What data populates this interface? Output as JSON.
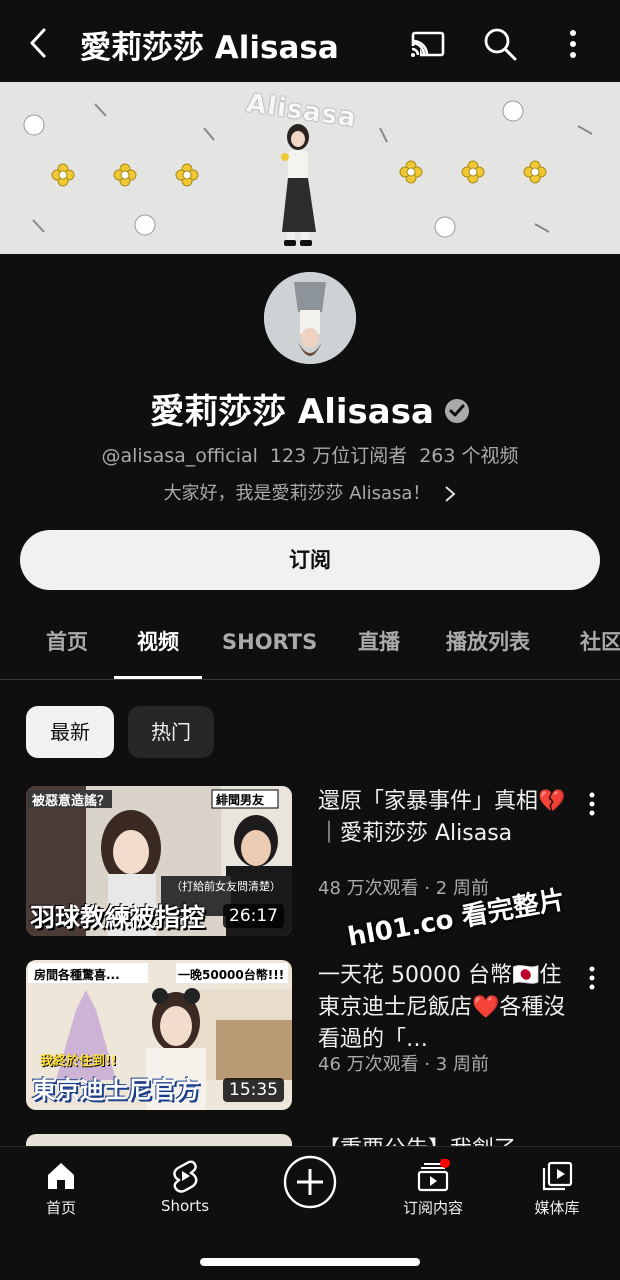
{
  "header": {
    "title": "愛莉莎莎 Alisasa"
  },
  "banner": {
    "brand_text": "Alisasa"
  },
  "channel": {
    "name": "愛莉莎莎 Alisasa",
    "handle": "@alisasa_official",
    "subscribers": "123 万位订阅者",
    "video_count": "263 个视频",
    "description": "大家好，我是愛莉莎莎 Alisasa！"
  },
  "subscribe_label": "订阅",
  "tabs": [
    {
      "label": "首页"
    },
    {
      "label": "视频"
    },
    {
      "label": "SHORTS"
    },
    {
      "label": "直播"
    },
    {
      "label": "播放列表"
    },
    {
      "label": "社区"
    }
  ],
  "filters": {
    "latest": "最新",
    "popular": "热门"
  },
  "videos": [
    {
      "title": "還原「家暴事件」真相💔｜愛莉莎莎 Alisasa",
      "meta": "48 万次观看 · 2 周前",
      "duration": "26:17",
      "thumb_texts": {
        "caption": "羽球教練被指控",
        "tag_left": "被惡意造謠？",
        "tag_right": "緋聞男友",
        "sub": "（打給前女友問清楚）"
      }
    },
    {
      "title": "一天花 50000 台幣🇯🇵住東京迪士尼飯店❤️各種沒看過的「…",
      "meta": "46 万次观看 · 3 周前",
      "duration": "15:35",
      "thumb_texts": {
        "caption": "東京迪士尼官方",
        "tag_left": "房間各種驚喜...",
        "tag_right": "一晚50000台幣!!!",
        "sub": "我終於住到!!"
      }
    },
    {
      "title": "【重要公告】我創了…",
      "meta": "",
      "duration": "",
      "thumb_texts": {}
    }
  ],
  "watermark": "hl01.co 看完整片",
  "bottom_nav": [
    {
      "label": "首页",
      "icon": "home-icon"
    },
    {
      "label": "Shorts",
      "icon": "shorts-icon"
    },
    {
      "label": "",
      "icon": "create-icon"
    },
    {
      "label": "订阅内容",
      "icon": "subscriptions-icon"
    },
    {
      "label": "媒体库",
      "icon": "library-icon"
    }
  ],
  "colors": {
    "background": "#0f0f0f",
    "accent_red": "#ff0000",
    "text_secondary": "#aaaaaa"
  }
}
